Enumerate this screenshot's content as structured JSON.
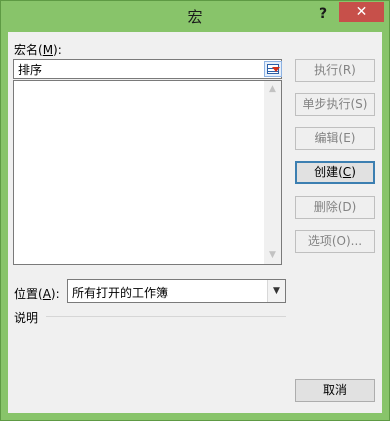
{
  "window": {
    "title": "宏",
    "help_label": "?",
    "close_label": "✕",
    "accent_color": "#88c46a",
    "close_color": "#c7504a"
  },
  "macro_name": {
    "label_pre": "宏名(",
    "label_key": "M",
    "label_post": "):",
    "value": "排序"
  },
  "macro_list": {
    "items": []
  },
  "buttons": {
    "run": {
      "label": "执行(R)",
      "enabled": false
    },
    "step_into": {
      "label": "单步执行(S)",
      "enabled": false
    },
    "edit": {
      "label": "编辑(E)",
      "enabled": false
    },
    "create": {
      "label_pre": "创建(",
      "label_key": "C",
      "label_post": ")",
      "enabled": true
    },
    "delete": {
      "label": "删除(D)",
      "enabled": false
    },
    "options": {
      "label": "选项(O)...",
      "enabled": false
    },
    "cancel": {
      "label": "取消",
      "enabled": true
    }
  },
  "location": {
    "label_pre": "位置(",
    "label_key": "A",
    "label_post": "):",
    "selected": "所有打开的工作簿"
  },
  "description": {
    "label": "说明"
  }
}
